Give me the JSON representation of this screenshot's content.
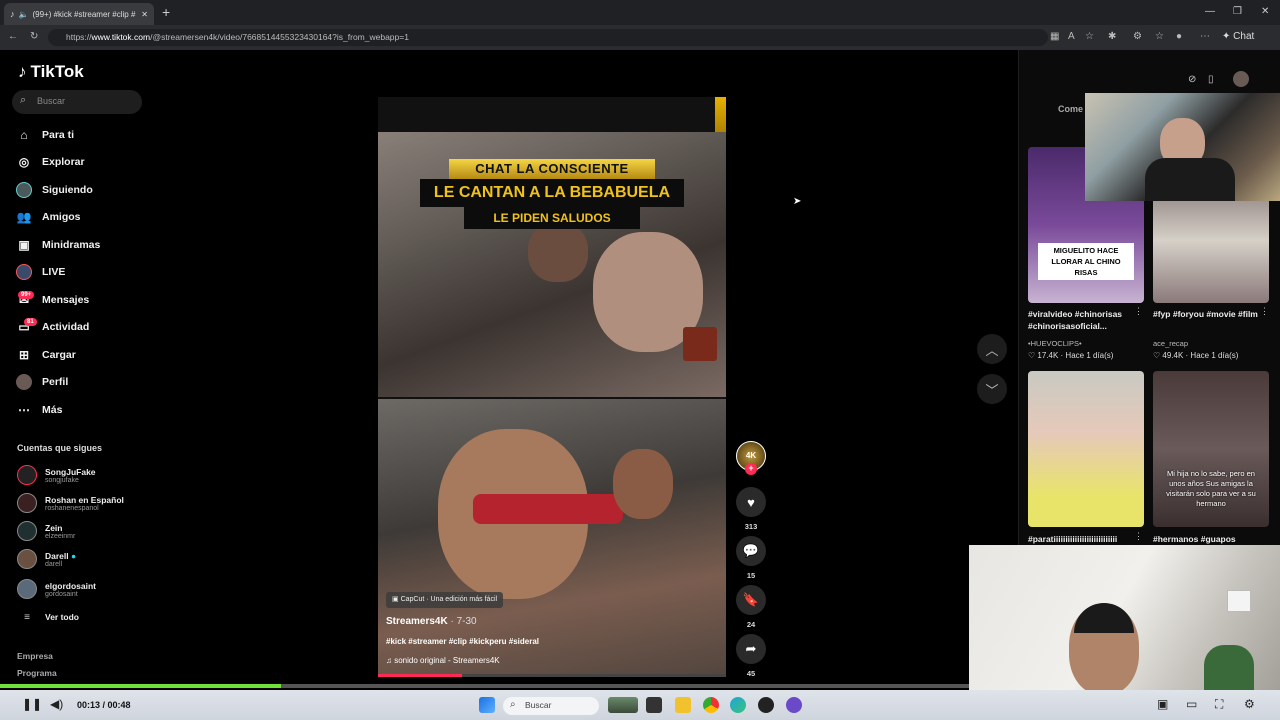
{
  "browser": {
    "tab_title": "(99+) #kick #streamer #clip #",
    "new_tab": "+",
    "url_scheme": "https://",
    "url_host": "www.tiktok.com",
    "url_path": "/@streamersen4k/video/7668514455323430164?is_from_webapp=1",
    "chat_label": "Chat"
  },
  "sidebar": {
    "logo": "TikTok",
    "search_placeholder": "Buscar",
    "items": [
      {
        "label": "Para ti",
        "icon": "home-icon"
      },
      {
        "label": "Explorar",
        "icon": "compass-icon"
      },
      {
        "label": "Siguiendo",
        "icon": "following-icon"
      },
      {
        "label": "Amigos",
        "icon": "friends-icon"
      },
      {
        "label": "Minidramas",
        "icon": "film-icon"
      },
      {
        "label": "LIVE",
        "icon": "live-icon"
      },
      {
        "label": "Mensajes",
        "icon": "messages-icon",
        "badge": "99+"
      },
      {
        "label": "Actividad",
        "icon": "activity-icon",
        "badge": "81"
      },
      {
        "label": "Cargar",
        "icon": "upload-icon"
      },
      {
        "label": "Perfil",
        "icon": "profile-icon"
      },
      {
        "label": "Más",
        "icon": "more-icon"
      }
    ],
    "following_title": "Cuentas que sigues",
    "accounts": [
      {
        "name": "SongJuFake",
        "handle": "songjufake"
      },
      {
        "name": "Roshan en Español",
        "handle": "roshanenespanol"
      },
      {
        "name": "Zein",
        "handle": "elzeeinmr"
      },
      {
        "name": "Darell",
        "handle": "darell"
      },
      {
        "name": "elgordosaint",
        "handle": "gordosaint"
      }
    ],
    "see_all": "Ver todo",
    "footer": [
      "Empresa",
      "Programa"
    ]
  },
  "video": {
    "overlay_line1": "CHAT LA CONSCIENTE",
    "overlay_line2": "LE CANTAN A LA BEBABUELA",
    "overlay_line3": "LE PIDEN SALUDOS",
    "capcut": "CapCut · Una edición más fácil",
    "author": "Streamers4K",
    "date": " · 7-30",
    "tags": "#kick #streamer #clip #kickperu #sideral",
    "sound": "sonido original - Streamers4K",
    "progress": 0.24
  },
  "actions": {
    "avatar_label": "4K",
    "likes": "313",
    "comments": "15",
    "saves": "24",
    "shares": "45"
  },
  "right_panel": {
    "tab_label": "Come",
    "items": [
      {
        "overlay": "MIGUELITO HACE LLORAR AL CHINO RISAS",
        "caption": "#viralvideo #chinorisas #chinorisasoficial...",
        "author": "•HUEVOCLIPS•",
        "likes": "17.4K",
        "time": "Hace 1 día(s)"
      },
      {
        "overlay": "",
        "caption": "#fyp #foryou #movie #film",
        "author": "ace_recap",
        "likes": "49.4K",
        "time": "Hace 1 día(s)"
      },
      {
        "overlay": "",
        "caption": "#paratiiiiiiiiiiiiiiiiiiiiiiiiiii",
        "author": "",
        "likes": "",
        "time": ""
      },
      {
        "overlay": "Mi hija no lo sabe, pero en unos años Sus amigas la visitarán solo para ver a su hermano",
        "caption": "#hermanos #guapos",
        "author": "",
        "likes": "",
        "time": ""
      }
    ]
  },
  "player": {
    "time": "00:13 / 00:48",
    "progress": 0.29
  },
  "taskbar": {
    "search": "Buscar"
  },
  "colors": {
    "accent": "#fe2c55",
    "gold": "#f0c21b",
    "player_progress": "#6fe13a"
  }
}
